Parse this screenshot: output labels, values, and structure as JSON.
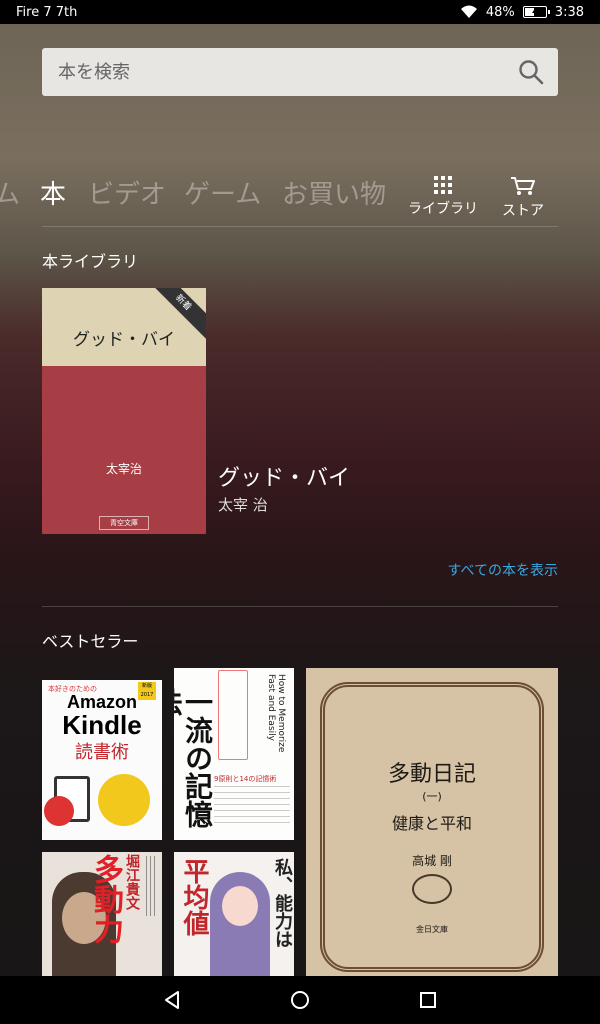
{
  "status": {
    "device": "Fire 7 7th",
    "battery": "48%",
    "battery_level": 0.48,
    "time": "3:38"
  },
  "search": {
    "placeholder": "本を検索"
  },
  "tabs": [
    {
      "label": "ム",
      "active": false
    },
    {
      "label": "本",
      "active": true
    },
    {
      "label": "ビデオ",
      "active": false
    },
    {
      "label": "ゲーム",
      "active": false
    },
    {
      "label": "お買い物",
      "active": false
    }
  ],
  "nav": {
    "library": "ライブラリ",
    "store": "ストア"
  },
  "library": {
    "title": "本ライブラリ",
    "book": {
      "cover_title": "グッド・バイ",
      "cover_author": "太宰治",
      "cover_publisher": "青空文庫",
      "cover_badge": "新着",
      "title": "グッド・バイ",
      "author": "太宰 治"
    },
    "show_all": "すべての本を表示"
  },
  "bestsellers": {
    "title": "ベストセラー",
    "books": [
      {
        "lines": [
          "Amazon",
          "Kindle",
          "読書術"
        ],
        "badge": "新版 2017",
        "top": "本好きのための"
      },
      {
        "lines": [
          "一流の記憶法",
          "How to Memorize Fast and Easily"
        ],
        "sub": "9原則と14の記憶術"
      },
      {
        "lines": [
          "多動日記",
          "(一)",
          "健康と平和",
          "高城 剛"
        ],
        "publisher": "金日文庫"
      },
      {
        "lines": [
          "多動力",
          "堀江貴文"
        ]
      },
      {
        "lines": [
          "平均値",
          "私、能力は"
        ]
      }
    ]
  },
  "colors": {
    "link": "#39a8e0",
    "cover_red": "#a73e45",
    "cover_cream": "#ded3b3"
  }
}
